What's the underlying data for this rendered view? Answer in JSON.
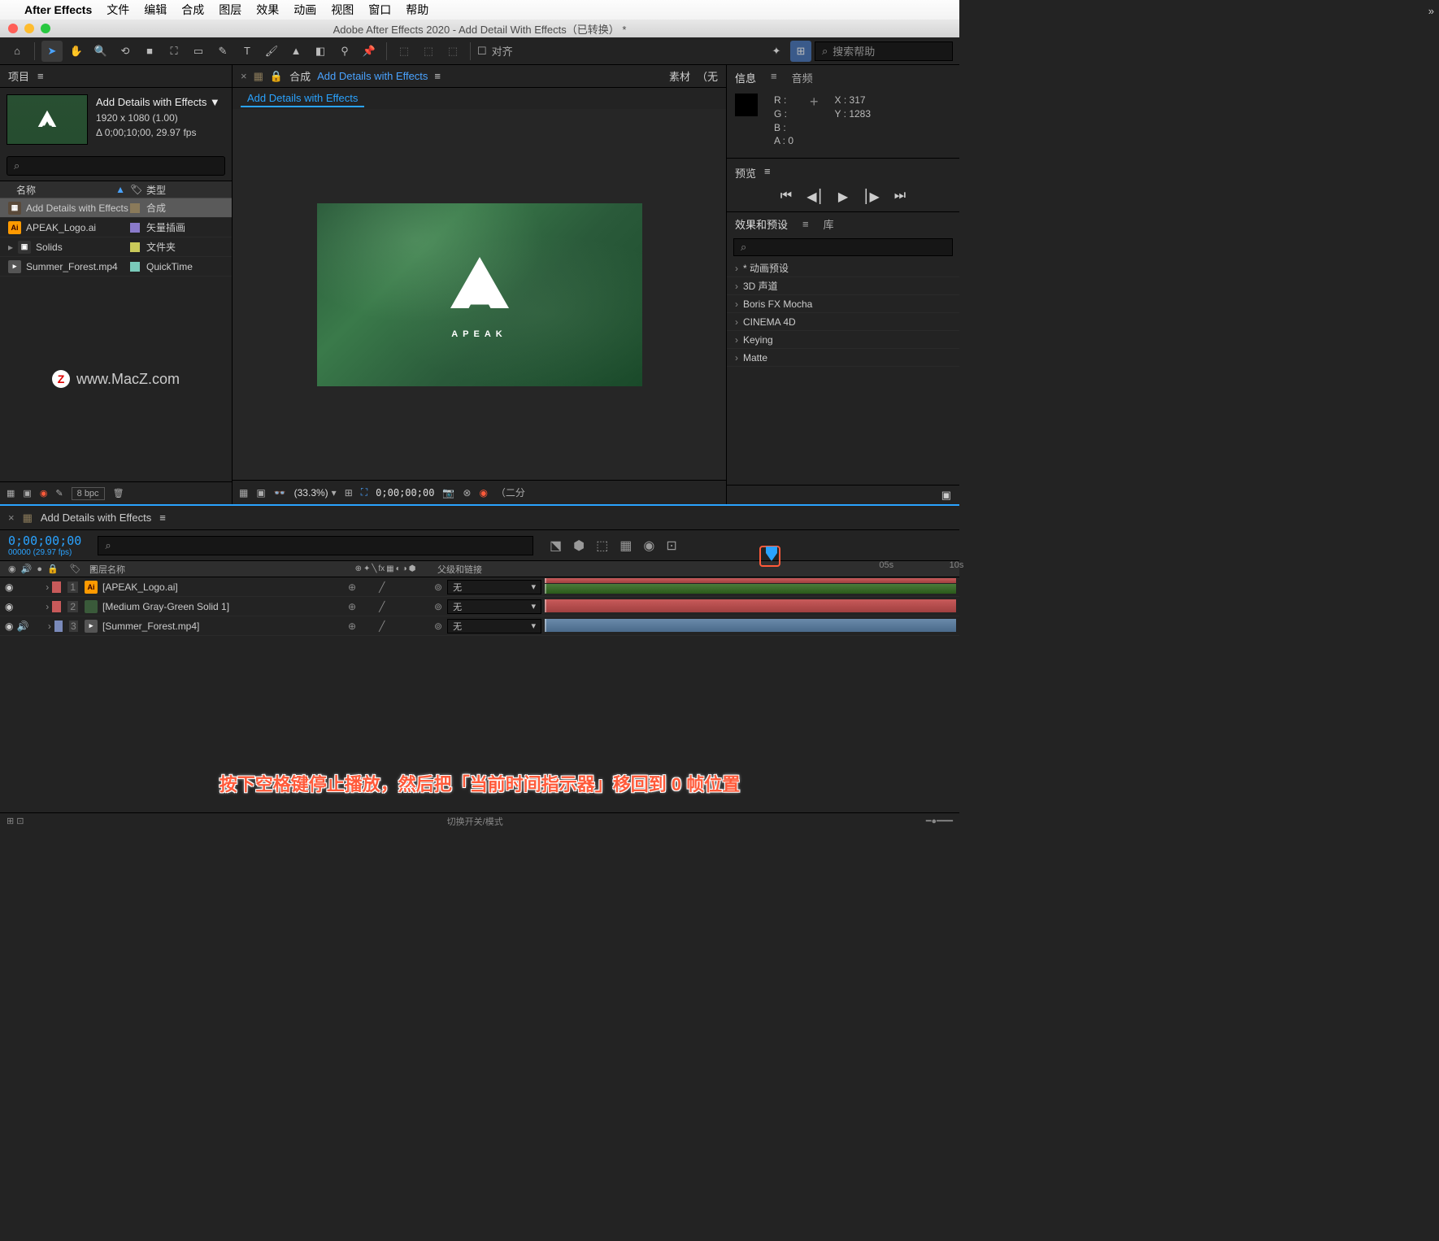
{
  "menubar": {
    "appname": "After Effects",
    "items": [
      "文件",
      "编辑",
      "合成",
      "图层",
      "效果",
      "动画",
      "视图",
      "窗口",
      "帮助"
    ]
  },
  "window": {
    "title": "Adobe After Effects 2020 - Add Detail With Effects（已转换） *"
  },
  "toolbar": {
    "align": "对齐",
    "search_placeholder": "搜索帮助"
  },
  "project": {
    "title": "项目",
    "comp_name": "Add Details with Effects ▼",
    "resolution": "1920 x 1080 (1.00)",
    "duration": "Δ 0;00;10;00, 29.97 fps",
    "cols": {
      "name": "名称",
      "type": "类型"
    },
    "items": [
      {
        "name": "Add Details with Effects",
        "type": "合成",
        "icon": "comp",
        "color": "#8a7a5a"
      },
      {
        "name": "APEAK_Logo.ai",
        "type": "矢量插画",
        "icon": "ai",
        "color": "#8a7aca"
      },
      {
        "name": "Solids",
        "type": "文件夹",
        "icon": "fld",
        "color": "#caca5a"
      },
      {
        "name": "Summer_Forest.mp4",
        "type": "QuickTime",
        "icon": "mov",
        "color": "#7acaba"
      }
    ],
    "watermark": "www.MacZ.com",
    "bpc": "8 bpc"
  },
  "composition": {
    "panel": "合成",
    "tab": "Add Details with Effects",
    "footage": "素材",
    "none": "（无",
    "brand": "APEAK",
    "zoom": "(33.3%)",
    "timecode": "0;00;00;00",
    "res": "（二分"
  },
  "info": {
    "tab1": "信息",
    "tab2": "音频",
    "r": "R :",
    "g": "G :",
    "b": "B :",
    "a": "A :  0",
    "x": "X : 317",
    "y": "Y : 1283"
  },
  "preview_panel": {
    "title": "预览"
  },
  "effects": {
    "tab1": "效果和预设",
    "tab2": "库",
    "items": [
      "* 动画预设",
      "3D 声道",
      "Boris FX Mocha",
      "CINEMA 4D",
      "Keying",
      "Matte"
    ]
  },
  "timeline": {
    "comp": "Add Details with Effects",
    "time": "0;00;00;00",
    "frame": "00000 (29.97 fps)",
    "cols": {
      "layername": "图层名称",
      "parent": "父级和链接"
    },
    "ruler": {
      "m1": "05s",
      "m2": "10s"
    },
    "layers": [
      {
        "num": "1",
        "name": "[APEAK_Logo.ai]",
        "icon": "ai",
        "color": "#c85a5a",
        "parent": "无"
      },
      {
        "num": "2",
        "name": "[Medium Gray-Green Solid 1]",
        "icon": "solid",
        "color": "#c85a5a",
        "parent": "无"
      },
      {
        "num": "3",
        "name": "[Summer_Forest.mp4]",
        "icon": "mov",
        "color": "#7a8aba",
        "parent": "无"
      }
    ],
    "switches": "切换开关/模式"
  },
  "caption": "按下空格键停止播放，然后把「当前时间指示器」移回到 0 帧位置"
}
